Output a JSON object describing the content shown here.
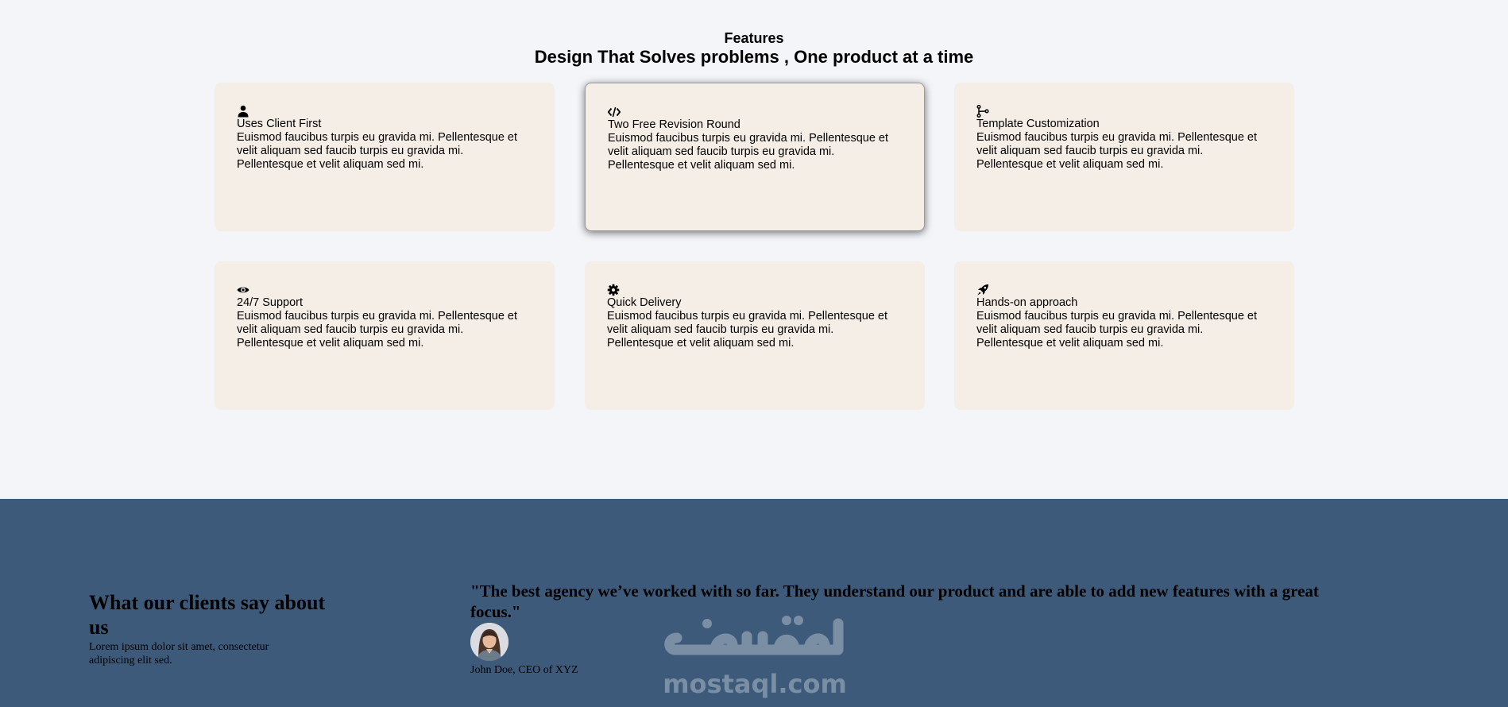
{
  "features": {
    "eyebrow": "Features",
    "title": "Design That Solves problems , One product at a time",
    "cards": [
      {
        "icon": "user-icon",
        "title": "Uses Client First",
        "description": "Euismod faucibus turpis eu gravida mi. Pellentesque et velit aliquam sed faucib turpis eu gravida mi. Pellentesque et velit aliquam sed mi."
      },
      {
        "icon": "code-icon",
        "title": "Two Free Revision Round",
        "description": "Euismod faucibus turpis eu gravida mi. Pellentesque et velit aliquam sed faucib turpis eu gravida mi. Pellentesque et velit aliquam sed mi."
      },
      {
        "icon": "code-branch-icon",
        "title": "Template Customization",
        "description": "Euismod faucibus turpis eu gravida mi. Pellentesque et velit aliquam sed faucib turpis eu gravida mi. Pellentesque et velit aliquam sed mi."
      },
      {
        "icon": "eye-icon",
        "title": "24/7 Support",
        "description": "Euismod faucibus turpis eu gravida mi. Pellentesque et velit aliquam sed faucib turpis eu gravida mi. Pellentesque et velit aliquam sed mi."
      },
      {
        "icon": "gear-icon",
        "title": "Quick Delivery",
        "description": "Euismod faucibus turpis eu gravida mi. Pellentesque et velit aliquam sed faucib turpis eu gravida mi. Pellentesque et velit aliquam sed mi."
      },
      {
        "icon": "rocket-icon",
        "title": "Hands-on approach",
        "description": "Euismod faucibus turpis eu gravida mi. Pellentesque et velit aliquam sed faucib turpis eu gravida mi. Pellentesque et velit aliquam sed mi."
      }
    ]
  },
  "testimonials": {
    "heading": "What our clients say about us",
    "subheading": "Lorem ipsum dolor sit amet, consectetur adipiscing elit sed.",
    "quote": "\"The best agency we’ve worked with so far. They understand our product and are able to add new features with a great focus.\"",
    "author": "John Doe, CEO of XYZ"
  },
  "watermark": {
    "text": "mostaql.com",
    "logo_text": "مستقل"
  },
  "colors": {
    "page_background": "#f3f5f9",
    "card_background": "#f5eee6",
    "testimonial_background": "#3e5a7a"
  }
}
